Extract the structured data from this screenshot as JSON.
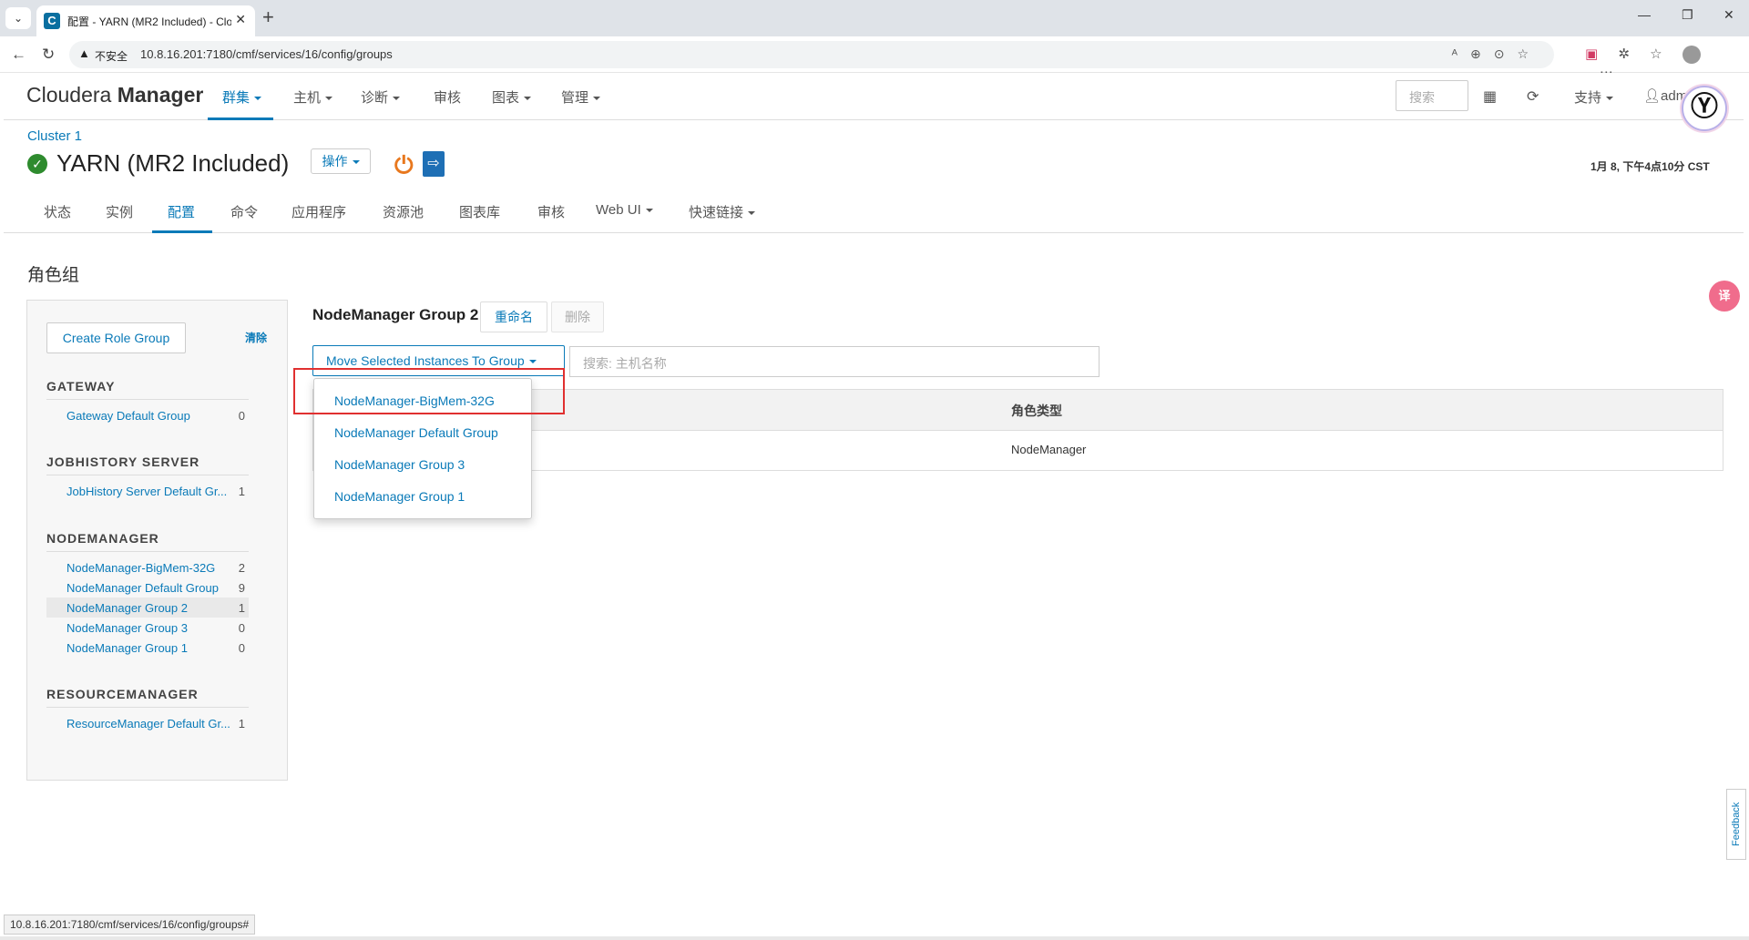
{
  "browser": {
    "tab_title": "配置 - YARN (MR2 Included) - Clou",
    "favicon_letter": "C",
    "insecure_label": "不安全",
    "url": "10.8.16.201:7180/cmf/services/16/config/groups",
    "status_url": "10.8.16.201:7180/cmf/services/16/config/groups#"
  },
  "app": {
    "logo_light": "Cloudera ",
    "logo_bold": "Manager",
    "nav": [
      {
        "label": "群集",
        "dropdown": true,
        "active": true
      },
      {
        "label": "主机",
        "dropdown": true
      },
      {
        "label": "诊断",
        "dropdown": true
      },
      {
        "label": "审核",
        "dropdown": false
      },
      {
        "label": "图表",
        "dropdown": true
      },
      {
        "label": "管理",
        "dropdown": true
      }
    ],
    "search_placeholder": "搜索",
    "support_label": "支持",
    "user_label": "admin"
  },
  "service": {
    "breadcrumb": "Cluster 1",
    "title": "YARN (MR2 Included)",
    "actions_label": "操作",
    "timestamp": "1月 8, 下午4点10分 CST",
    "tabs": [
      {
        "label": "状态"
      },
      {
        "label": "实例"
      },
      {
        "label": "配置",
        "active": true
      },
      {
        "label": "命令"
      },
      {
        "label": "应用程序"
      },
      {
        "label": "资源池"
      },
      {
        "label": "图表库"
      },
      {
        "label": "审核"
      },
      {
        "label": "Web UI",
        "dropdown": true
      },
      {
        "label": "快速链接",
        "dropdown": true
      }
    ]
  },
  "page": {
    "heading": "角色组",
    "create_label": "Create Role Group",
    "clear_label": "清除",
    "sections": [
      {
        "title": "GATEWAY",
        "groups": [
          {
            "name": "Gateway Default Group",
            "count": "0"
          }
        ]
      },
      {
        "title": "JOBHISTORY SERVER",
        "groups": [
          {
            "name": "JobHistory Server Default Gr...",
            "count": "1"
          }
        ]
      },
      {
        "title": "NODEMANAGER",
        "groups": [
          {
            "name": "NodeManager-BigMem-32G",
            "count": "2"
          },
          {
            "name": "NodeManager Default Group",
            "count": "9"
          },
          {
            "name": "NodeManager Group 2",
            "count": "1",
            "selected": true
          },
          {
            "name": "NodeManager Group 3",
            "count": "0"
          },
          {
            "name": "NodeManager Group 1",
            "count": "0"
          }
        ]
      },
      {
        "title": "RESOURCEMANAGER",
        "groups": [
          {
            "name": "ResourceManager Default Gr...",
            "count": "1"
          }
        ]
      }
    ],
    "group_title": "NodeManager Group 2",
    "rename_label": "重命名",
    "delete_label": "删除",
    "move_label": "Move Selected Instances To Group",
    "host_search_placeholder": "搜索: 主机名称",
    "table": {
      "header_role_type": "角色类型",
      "rows": [
        {
          "role_type": "NodeManager"
        }
      ]
    },
    "move_options": [
      "NodeManager-BigMem-32G",
      "NodeManager Default Group",
      "NodeManager Group 3",
      "NodeManager Group 1"
    ],
    "feedback_label": "Feedback"
  },
  "colors": {
    "accent": "#0a7ab8",
    "status_ok": "#2e8b2e",
    "highlight": "#e03030",
    "power": "#e8781e"
  }
}
